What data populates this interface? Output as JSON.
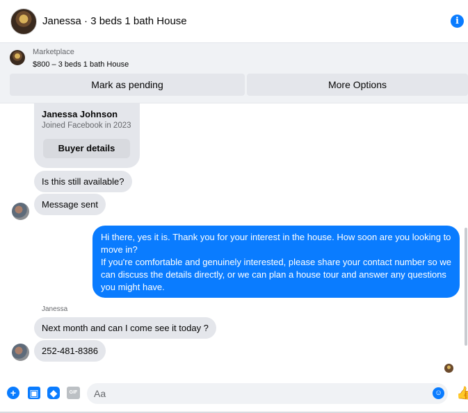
{
  "header": {
    "title": "Janessa · 3 beds 1 bath House",
    "info_icon": "info-icon"
  },
  "marketplace": {
    "label": "Marketplace",
    "listing": "$800 – 3 beds 1 bath House",
    "actions": {
      "pending": "Mark as pending",
      "more": "More Options"
    }
  },
  "buyer_card": {
    "name": "Janessa Johnson",
    "joined": "Joined Facebook in 2023",
    "details_button": "Buyer details"
  },
  "messages": {
    "m1": "Is this still available?",
    "m2": "Message sent",
    "m3": "Hi there, yes it is. Thank you for your interest in the house. How soon are you looking to move in?\nIf you're comfortable and genuinely interested, please share your contact number so we can discuss the details directly, or we can plan a house tour and answer any questions you might have.",
    "sender": "Janessa",
    "m4": "Next month and can I come see it today ?",
    "m5": "252-481-8386"
  },
  "composer": {
    "placeholder": "Aa",
    "gif_label": "GIF"
  },
  "colors": {
    "accent": "#0a7cff",
    "incoming_bubble": "#e4e6eb",
    "panel": "#f0f2f5"
  }
}
